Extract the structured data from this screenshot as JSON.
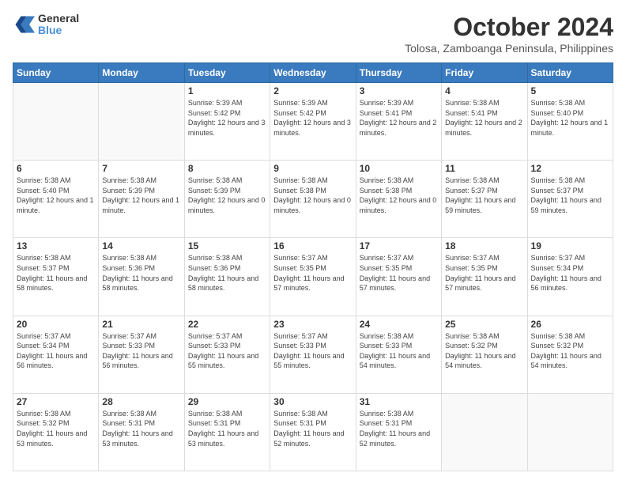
{
  "logo": {
    "line1": "General",
    "line2": "Blue"
  },
  "header": {
    "title": "October 2024",
    "subtitle": "Tolosa, Zamboanga Peninsula, Philippines"
  },
  "weekdays": [
    "Sunday",
    "Monday",
    "Tuesday",
    "Wednesday",
    "Thursday",
    "Friday",
    "Saturday"
  ],
  "weeks": [
    [
      {
        "day": "",
        "sunrise": "",
        "sunset": "",
        "daylight": ""
      },
      {
        "day": "",
        "sunrise": "",
        "sunset": "",
        "daylight": ""
      },
      {
        "day": "1",
        "sunrise": "Sunrise: 5:39 AM",
        "sunset": "Sunset: 5:42 PM",
        "daylight": "Daylight: 12 hours and 3 minutes."
      },
      {
        "day": "2",
        "sunrise": "Sunrise: 5:39 AM",
        "sunset": "Sunset: 5:42 PM",
        "daylight": "Daylight: 12 hours and 3 minutes."
      },
      {
        "day": "3",
        "sunrise": "Sunrise: 5:39 AM",
        "sunset": "Sunset: 5:41 PM",
        "daylight": "Daylight: 12 hours and 2 minutes."
      },
      {
        "day": "4",
        "sunrise": "Sunrise: 5:38 AM",
        "sunset": "Sunset: 5:41 PM",
        "daylight": "Daylight: 12 hours and 2 minutes."
      },
      {
        "day": "5",
        "sunrise": "Sunrise: 5:38 AM",
        "sunset": "Sunset: 5:40 PM",
        "daylight": "Daylight: 12 hours and 1 minute."
      }
    ],
    [
      {
        "day": "6",
        "sunrise": "Sunrise: 5:38 AM",
        "sunset": "Sunset: 5:40 PM",
        "daylight": "Daylight: 12 hours and 1 minute."
      },
      {
        "day": "7",
        "sunrise": "Sunrise: 5:38 AM",
        "sunset": "Sunset: 5:39 PM",
        "daylight": "Daylight: 12 hours and 1 minute."
      },
      {
        "day": "8",
        "sunrise": "Sunrise: 5:38 AM",
        "sunset": "Sunset: 5:39 PM",
        "daylight": "Daylight: 12 hours and 0 minutes."
      },
      {
        "day": "9",
        "sunrise": "Sunrise: 5:38 AM",
        "sunset": "Sunset: 5:38 PM",
        "daylight": "Daylight: 12 hours and 0 minutes."
      },
      {
        "day": "10",
        "sunrise": "Sunrise: 5:38 AM",
        "sunset": "Sunset: 5:38 PM",
        "daylight": "Daylight: 12 hours and 0 minutes."
      },
      {
        "day": "11",
        "sunrise": "Sunrise: 5:38 AM",
        "sunset": "Sunset: 5:37 PM",
        "daylight": "Daylight: 11 hours and 59 minutes."
      },
      {
        "day": "12",
        "sunrise": "Sunrise: 5:38 AM",
        "sunset": "Sunset: 5:37 PM",
        "daylight": "Daylight: 11 hours and 59 minutes."
      }
    ],
    [
      {
        "day": "13",
        "sunrise": "Sunrise: 5:38 AM",
        "sunset": "Sunset: 5:37 PM",
        "daylight": "Daylight: 11 hours and 58 minutes."
      },
      {
        "day": "14",
        "sunrise": "Sunrise: 5:38 AM",
        "sunset": "Sunset: 5:36 PM",
        "daylight": "Daylight: 11 hours and 58 minutes."
      },
      {
        "day": "15",
        "sunrise": "Sunrise: 5:38 AM",
        "sunset": "Sunset: 5:36 PM",
        "daylight": "Daylight: 11 hours and 58 minutes."
      },
      {
        "day": "16",
        "sunrise": "Sunrise: 5:37 AM",
        "sunset": "Sunset: 5:35 PM",
        "daylight": "Daylight: 11 hours and 57 minutes."
      },
      {
        "day": "17",
        "sunrise": "Sunrise: 5:37 AM",
        "sunset": "Sunset: 5:35 PM",
        "daylight": "Daylight: 11 hours and 57 minutes."
      },
      {
        "day": "18",
        "sunrise": "Sunrise: 5:37 AM",
        "sunset": "Sunset: 5:35 PM",
        "daylight": "Daylight: 11 hours and 57 minutes."
      },
      {
        "day": "19",
        "sunrise": "Sunrise: 5:37 AM",
        "sunset": "Sunset: 5:34 PM",
        "daylight": "Daylight: 11 hours and 56 minutes."
      }
    ],
    [
      {
        "day": "20",
        "sunrise": "Sunrise: 5:37 AM",
        "sunset": "Sunset: 5:34 PM",
        "daylight": "Daylight: 11 hours and 56 minutes."
      },
      {
        "day": "21",
        "sunrise": "Sunrise: 5:37 AM",
        "sunset": "Sunset: 5:33 PM",
        "daylight": "Daylight: 11 hours and 56 minutes."
      },
      {
        "day": "22",
        "sunrise": "Sunrise: 5:37 AM",
        "sunset": "Sunset: 5:33 PM",
        "daylight": "Daylight: 11 hours and 55 minutes."
      },
      {
        "day": "23",
        "sunrise": "Sunrise: 5:37 AM",
        "sunset": "Sunset: 5:33 PM",
        "daylight": "Daylight: 11 hours and 55 minutes."
      },
      {
        "day": "24",
        "sunrise": "Sunrise: 5:38 AM",
        "sunset": "Sunset: 5:33 PM",
        "daylight": "Daylight: 11 hours and 54 minutes."
      },
      {
        "day": "25",
        "sunrise": "Sunrise: 5:38 AM",
        "sunset": "Sunset: 5:32 PM",
        "daylight": "Daylight: 11 hours and 54 minutes."
      },
      {
        "day": "26",
        "sunrise": "Sunrise: 5:38 AM",
        "sunset": "Sunset: 5:32 PM",
        "daylight": "Daylight: 11 hours and 54 minutes."
      }
    ],
    [
      {
        "day": "27",
        "sunrise": "Sunrise: 5:38 AM",
        "sunset": "Sunset: 5:32 PM",
        "daylight": "Daylight: 11 hours and 53 minutes."
      },
      {
        "day": "28",
        "sunrise": "Sunrise: 5:38 AM",
        "sunset": "Sunset: 5:31 PM",
        "daylight": "Daylight: 11 hours and 53 minutes."
      },
      {
        "day": "29",
        "sunrise": "Sunrise: 5:38 AM",
        "sunset": "Sunset: 5:31 PM",
        "daylight": "Daylight: 11 hours and 53 minutes."
      },
      {
        "day": "30",
        "sunrise": "Sunrise: 5:38 AM",
        "sunset": "Sunset: 5:31 PM",
        "daylight": "Daylight: 11 hours and 52 minutes."
      },
      {
        "day": "31",
        "sunrise": "Sunrise: 5:38 AM",
        "sunset": "Sunset: 5:31 PM",
        "daylight": "Daylight: 11 hours and 52 minutes."
      },
      {
        "day": "",
        "sunrise": "",
        "sunset": "",
        "daylight": ""
      },
      {
        "day": "",
        "sunrise": "",
        "sunset": "",
        "daylight": ""
      }
    ]
  ]
}
